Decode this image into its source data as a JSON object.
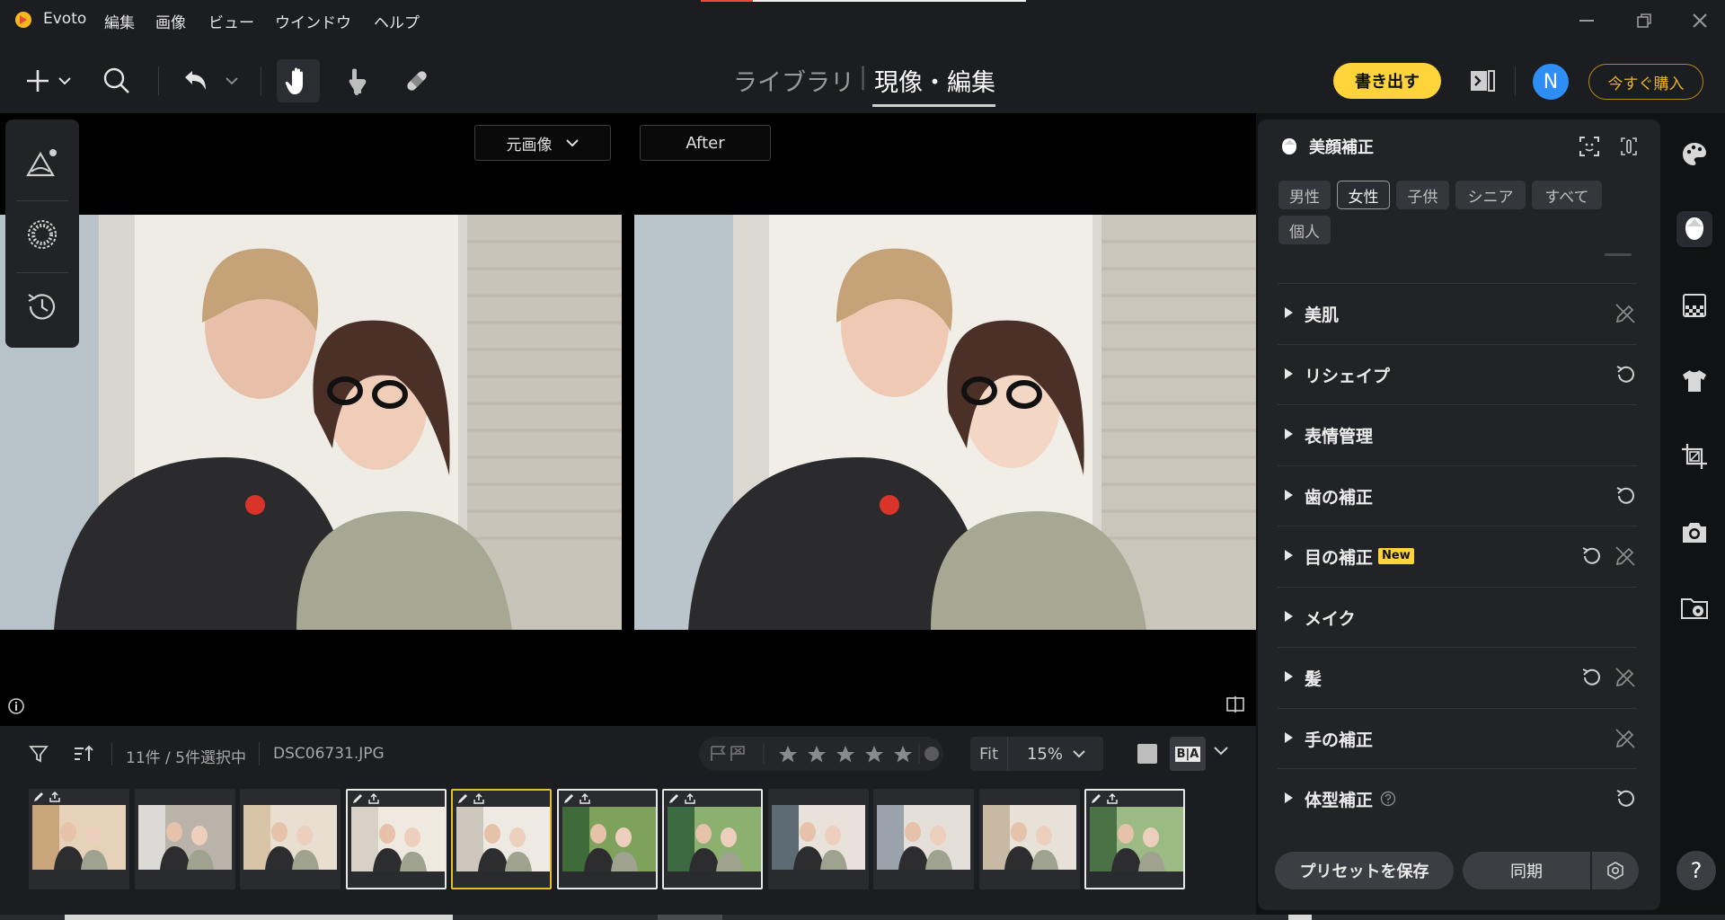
{
  "app": {
    "name": "Evoto"
  },
  "menu": [
    "編集",
    "画像",
    "ビュー",
    "ウインドウ",
    "ヘルプ"
  ],
  "modes": {
    "library": "ライブラリ",
    "edit": "現像・編集",
    "separator": "|"
  },
  "toolbar": {
    "export_label": "書き出す",
    "avatar_initial": "N",
    "buy_label": "今すぐ購入"
  },
  "canvas": {
    "before_label": "元画像",
    "after_label": "After"
  },
  "filmstrip": {
    "count": "11件 / 5件選択中",
    "filename": "DSC06731.JPG",
    "zoom_fit": "Fit",
    "zoom_level": "15%",
    "ba_label": "B|A",
    "thumbnails": [
      {
        "edited": true,
        "exported": true,
        "state": "none"
      },
      {
        "edited": false,
        "exported": false,
        "state": "none"
      },
      {
        "edited": false,
        "exported": false,
        "state": "none"
      },
      {
        "edited": true,
        "exported": true,
        "state": "selected"
      },
      {
        "edited": true,
        "exported": true,
        "state": "current"
      },
      {
        "edited": true,
        "exported": true,
        "state": "selected"
      },
      {
        "edited": true,
        "exported": true,
        "state": "selected"
      },
      {
        "edited": false,
        "exported": false,
        "state": "none"
      },
      {
        "edited": false,
        "exported": false,
        "state": "none"
      },
      {
        "edited": false,
        "exported": false,
        "state": "none"
      },
      {
        "edited": true,
        "exported": true,
        "state": "selected"
      }
    ]
  },
  "panel": {
    "title": "美顔補正",
    "chips": [
      "男性",
      "女性",
      "子供",
      "シニア",
      "すべて",
      "個人"
    ],
    "active_chip": "女性",
    "sections": [
      {
        "label": "美肌",
        "icons": [
          "edit-off"
        ]
      },
      {
        "label": "リシェイプ",
        "icons": [
          "reset"
        ]
      },
      {
        "label": "表情管理",
        "icons": []
      },
      {
        "label": "歯の補正",
        "icons": [
          "reset"
        ]
      },
      {
        "label": "目の補正",
        "badge": "New",
        "icons": [
          "reset",
          "edit-off"
        ]
      },
      {
        "label": "メイク",
        "icons": []
      },
      {
        "label": "髪",
        "icons": [
          "reset",
          "edit-off"
        ]
      },
      {
        "label": "手の補正",
        "icons": [
          "edit-off"
        ]
      },
      {
        "label": "体型補正",
        "help": true,
        "icons": [
          "reset"
        ]
      }
    ],
    "save_preset_label": "プリセットを保存",
    "sync_label": "同期"
  },
  "help_label": "?",
  "progress": 0.16,
  "colors": {
    "accent": "#ffd43b",
    "avatar": "#2f8ef5",
    "buy": "#e3b42a",
    "progress": "#e84a3c"
  }
}
